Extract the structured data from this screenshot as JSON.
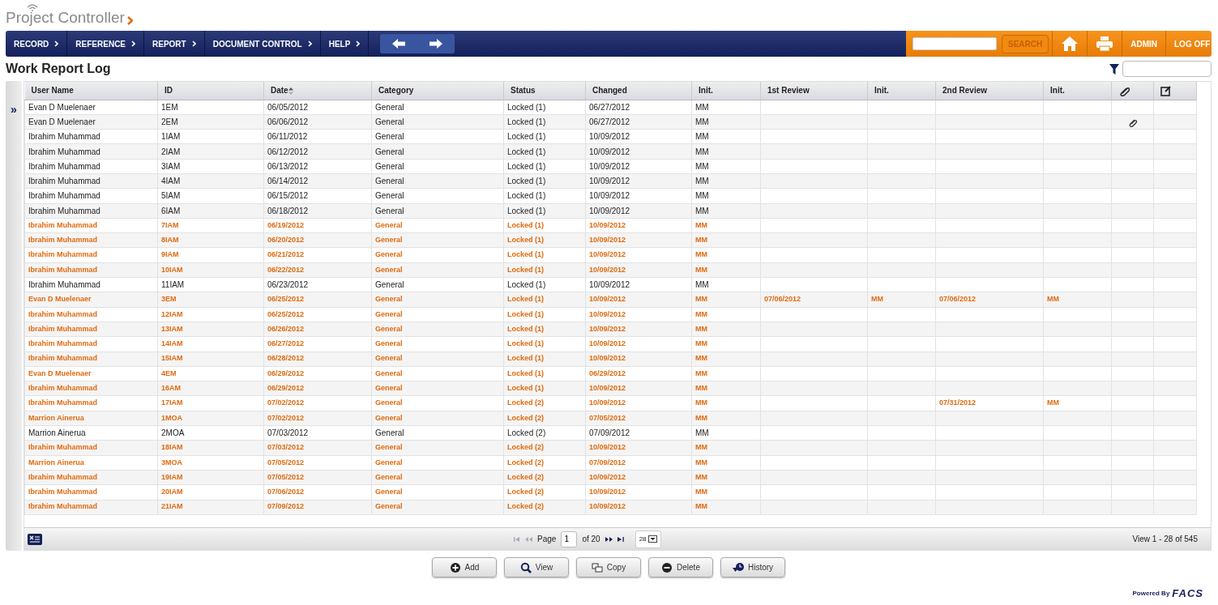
{
  "logo": {
    "title": "Project Controller"
  },
  "nav": {
    "menus": [
      {
        "label": "RECORD"
      },
      {
        "label": "REFERENCE"
      },
      {
        "label": "REPORT"
      },
      {
        "label": "DOCUMENT CONTROL"
      },
      {
        "label": "HELP"
      }
    ],
    "search_button": "SEARCH",
    "links": [
      "ADMIN",
      "LOG OFF"
    ]
  },
  "page": {
    "title": "Work Report Log"
  },
  "sidebar_toggle": "»",
  "table": {
    "columns": [
      {
        "label": "User Name",
        "kind": "text",
        "sorted": false
      },
      {
        "label": "ID",
        "kind": "text",
        "sorted": false
      },
      {
        "label": "Date",
        "kind": "text",
        "sorted": true
      },
      {
        "label": "Category",
        "kind": "text",
        "sorted": false
      },
      {
        "label": "Status",
        "kind": "text",
        "sorted": false
      },
      {
        "label": "Changed",
        "kind": "text",
        "sorted": false
      },
      {
        "label": "Init.",
        "kind": "text",
        "sorted": false
      },
      {
        "label": "1st Review",
        "kind": "text",
        "sorted": false
      },
      {
        "label": "Init.",
        "kind": "text",
        "sorted": false
      },
      {
        "label": "2nd Review",
        "kind": "text",
        "sorted": false
      },
      {
        "label": "Init.",
        "kind": "text",
        "sorted": false
      },
      {
        "kind": "attachment",
        "sorted": false
      },
      {
        "kind": "edit",
        "sorted": false
      }
    ],
    "rows": [
      {
        "highlighted": false,
        "attachment": false,
        "cells": [
          "Evan D Muelenaer",
          "1EM",
          "06/05/2012",
          "General",
          "Locked (1)",
          "06/27/2012",
          "MM"
        ]
      },
      {
        "highlighted": false,
        "attachment": true,
        "cells": [
          "Evan D Muelenaer",
          "2EM",
          "06/06/2012",
          "General",
          "Locked (1)",
          "06/27/2012",
          "MM"
        ]
      },
      {
        "highlighted": false,
        "attachment": false,
        "cells": [
          "Ibrahim Muhammad",
          "1IAM",
          "06/11/2012",
          "General",
          "Locked (1)",
          "10/09/2012",
          "MM"
        ]
      },
      {
        "highlighted": false,
        "attachment": false,
        "cells": [
          "Ibrahim Muhammad",
          "2IAM",
          "06/12/2012",
          "General",
          "Locked (1)",
          "10/09/2012",
          "MM"
        ]
      },
      {
        "highlighted": false,
        "attachment": false,
        "cells": [
          "Ibrahim Muhammad",
          "3IAM",
          "06/13/2012",
          "General",
          "Locked (1)",
          "10/09/2012",
          "MM"
        ]
      },
      {
        "highlighted": false,
        "attachment": false,
        "cells": [
          "Ibrahim Muhammad",
          "4IAM",
          "06/14/2012",
          "General",
          "Locked (1)",
          "10/09/2012",
          "MM"
        ]
      },
      {
        "highlighted": false,
        "attachment": false,
        "cells": [
          "Ibrahim Muhammad",
          "5IAM",
          "06/15/2012",
          "General",
          "Locked (1)",
          "10/09/2012",
          "MM"
        ]
      },
      {
        "highlighted": false,
        "attachment": false,
        "cells": [
          "Ibrahim Muhammad",
          "6IAM",
          "06/18/2012",
          "General",
          "Locked (1)",
          "10/09/2012",
          "MM"
        ]
      },
      {
        "highlighted": true,
        "attachment": false,
        "cells": [
          "Ibrahim Muhammad",
          "7IAM",
          "06/19/2012",
          "General",
          "Locked (1)",
          "10/09/2012",
          "MM"
        ]
      },
      {
        "highlighted": true,
        "attachment": false,
        "cells": [
          "Ibrahim Muhammad",
          "8IAM",
          "06/20/2012",
          "General",
          "Locked (1)",
          "10/09/2012",
          "MM"
        ]
      },
      {
        "highlighted": true,
        "attachment": false,
        "cells": [
          "Ibrahim Muhammad",
          "9IAM",
          "06/21/2012",
          "General",
          "Locked (1)",
          "10/09/2012",
          "MM"
        ]
      },
      {
        "highlighted": true,
        "attachment": false,
        "cells": [
          "Ibrahim Muhammad",
          "10IAM",
          "06/22/2012",
          "General",
          "Locked (1)",
          "10/09/2012",
          "MM"
        ]
      },
      {
        "highlighted": false,
        "attachment": false,
        "cells": [
          "Ibrahim Muhammad",
          "11IAM",
          "06/23/2012",
          "General",
          "Locked (1)",
          "10/09/2012",
          "MM"
        ]
      },
      {
        "highlighted": true,
        "attachment": false,
        "cells": [
          "Evan D Muelenaer",
          "3EM",
          "06/25/2012",
          "General",
          "Locked (1)",
          "10/09/2012",
          "MM"
        ],
        "first_review": {
          "date": "07/06/2012",
          "init": "MM"
        },
        "second_review": {
          "date": "07/06/2012",
          "init": "MM"
        }
      },
      {
        "highlighted": true,
        "attachment": false,
        "cells": [
          "Ibrahim Muhammad",
          "12IAM",
          "06/25/2012",
          "General",
          "Locked (1)",
          "10/09/2012",
          "MM"
        ]
      },
      {
        "highlighted": true,
        "attachment": false,
        "cells": [
          "Ibrahim Muhammad",
          "13IAM",
          "06/26/2012",
          "General",
          "Locked (1)",
          "10/09/2012",
          "MM"
        ]
      },
      {
        "highlighted": true,
        "attachment": false,
        "cells": [
          "Ibrahim Muhammad",
          "14IAM",
          "06/27/2012",
          "General",
          "Locked (1)",
          "10/09/2012",
          "MM"
        ]
      },
      {
        "highlighted": true,
        "attachment": false,
        "cells": [
          "Ibrahim Muhammad",
          "15IAM",
          "06/28/2012",
          "General",
          "Locked (1)",
          "10/09/2012",
          "MM"
        ]
      },
      {
        "highlighted": true,
        "attachment": false,
        "cells": [
          "Evan D Muelenaer",
          "4EM",
          "06/29/2012",
          "General",
          "Locked (1)",
          "06/29/2012",
          "MM"
        ]
      },
      {
        "highlighted": true,
        "attachment": false,
        "cells": [
          "Ibrahim Muhammad",
          "16AM",
          "06/29/2012",
          "General",
          "Locked (1)",
          "10/09/2012",
          "MM"
        ]
      },
      {
        "highlighted": true,
        "attachment": false,
        "cells": [
          "Ibrahim Muhammad",
          "17IAM",
          "07/02/2012",
          "General",
          "Locked (2)",
          "10/09/2012",
          "MM"
        ],
        "second_review": {
          "date": "07/31/2012",
          "init": "MM"
        }
      },
      {
        "highlighted": true,
        "attachment": false,
        "cells": [
          "Marrion Ainerua",
          "1MOA",
          "07/02/2012",
          "General",
          "Locked (2)",
          "07/05/2012",
          "MM"
        ]
      },
      {
        "highlighted": false,
        "attachment": false,
        "cells": [
          "Marrion Ainerua",
          "2MOA",
          "07/03/2012",
          "General",
          "Locked (2)",
          "07/09/2012",
          "MM"
        ]
      },
      {
        "highlighted": true,
        "attachment": false,
        "cells": [
          "Ibrahim Muhammad",
          "18IAM",
          "07/03/2012",
          "General",
          "Locked (2)",
          "10/09/2012",
          "MM"
        ]
      },
      {
        "highlighted": true,
        "attachment": false,
        "cells": [
          "Marrion Ainerua",
          "3MOA",
          "07/05/2012",
          "General",
          "Locked (2)",
          "07/09/2012",
          "MM"
        ]
      },
      {
        "highlighted": true,
        "attachment": false,
        "cells": [
          "Ibrahim Muhammad",
          "19IAM",
          "07/05/2012",
          "General",
          "Locked (2)",
          "10/09/2012",
          "MM"
        ]
      },
      {
        "highlighted": true,
        "attachment": false,
        "cells": [
          "Ibrahim Muhammad",
          "20IAM",
          "07/06/2012",
          "General",
          "Locked (2)",
          "10/09/2012",
          "MM"
        ]
      },
      {
        "highlighted": true,
        "attachment": false,
        "cells": [
          "Ibrahim Muhammad",
          "21IAM",
          "07/09/2012",
          "General",
          "Locked (2)",
          "10/09/2012",
          "MM"
        ]
      }
    ]
  },
  "pager": {
    "page_label": "Page",
    "page": "1",
    "of_label": "of 20",
    "page_size": "28",
    "summary": "View 1 - 28 of 545"
  },
  "buttons": [
    {
      "label": "Add",
      "kind": "add"
    },
    {
      "label": "View",
      "kind": "view"
    },
    {
      "label": "Copy",
      "kind": "copy"
    },
    {
      "label": "Delete",
      "kind": "delete"
    },
    {
      "label": "History",
      "kind": "history"
    }
  ],
  "footer": {
    "powered_by": "Powered By",
    "brand": "FACS"
  }
}
